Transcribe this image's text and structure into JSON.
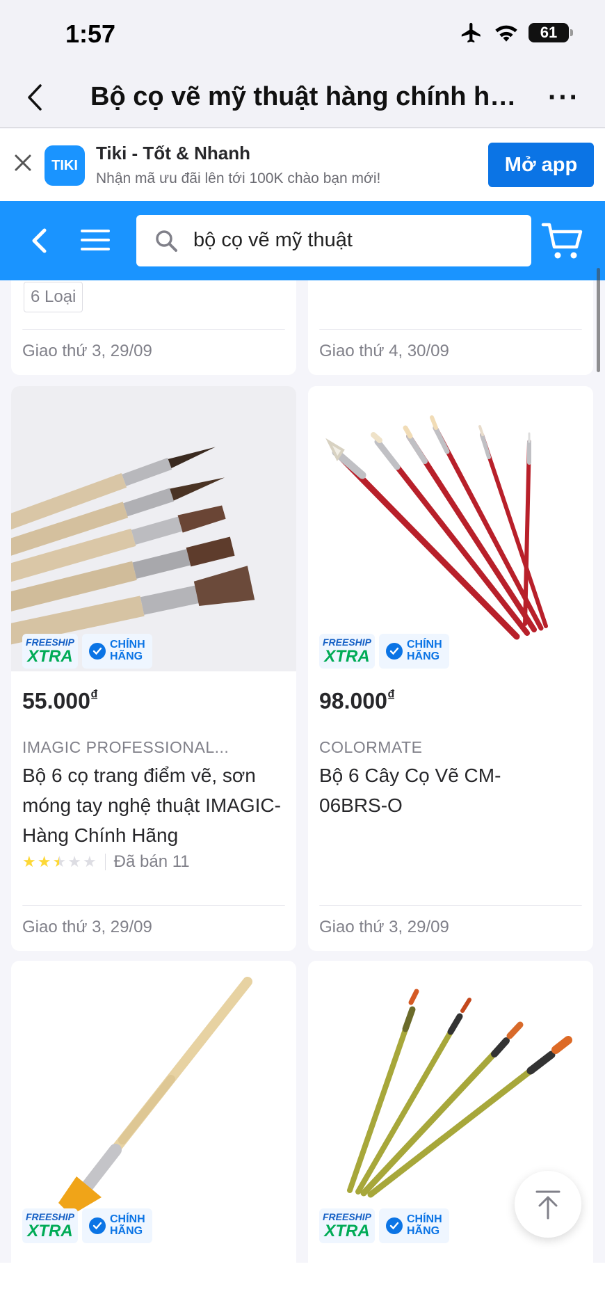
{
  "status_bar": {
    "time": "1:57",
    "battery": "61"
  },
  "browser": {
    "title": "Bộ cọ vẽ mỹ thuật hàng chính hãng...",
    "more": "···"
  },
  "app_banner": {
    "title": "Tiki - Tốt & Nhanh",
    "subtitle": "Nhận mã ưu đãi lên tới 100K chào bạn mới!",
    "logo_text": "TIKI",
    "open_button": "Mở app"
  },
  "search": {
    "query": "bộ cọ vẽ mỹ thuật"
  },
  "colors": {
    "brand_blue": "#1a94ff",
    "button_blue": "#0b74e5",
    "freeship_green": "#00ab56",
    "star_yellow": "#fdd836"
  },
  "badges": {
    "freeship_top": "FREESHIP",
    "freeship_bottom": "XTRA",
    "genuine_line1": "CHÍNH",
    "genuine_line2": "HÃNG"
  },
  "partial_cards": [
    {
      "variant": "6 Loại",
      "delivery": "Giao thứ 3, 29/09"
    },
    {
      "delivery": "Giao thứ 4, 30/09"
    }
  ],
  "products": [
    {
      "price": "55.000",
      "currency": "₫",
      "brand": "IMAGIC PROFESSIONAL...",
      "name": "Bộ 6 cọ trang điểm vẽ, sơn móng tay nghệ thuật IMAGIC- Hàng Chính Hãng",
      "rating": 2.5,
      "sold": "Đã bán 11",
      "delivery": "Giao thứ 3, 29/09"
    },
    {
      "price": "98.000",
      "currency": "₫",
      "brand": "COLORMATE",
      "name": "Bộ 6 Cây Cọ Vẽ CM-06BRS-O",
      "delivery": "Giao thứ 3, 29/09"
    }
  ]
}
